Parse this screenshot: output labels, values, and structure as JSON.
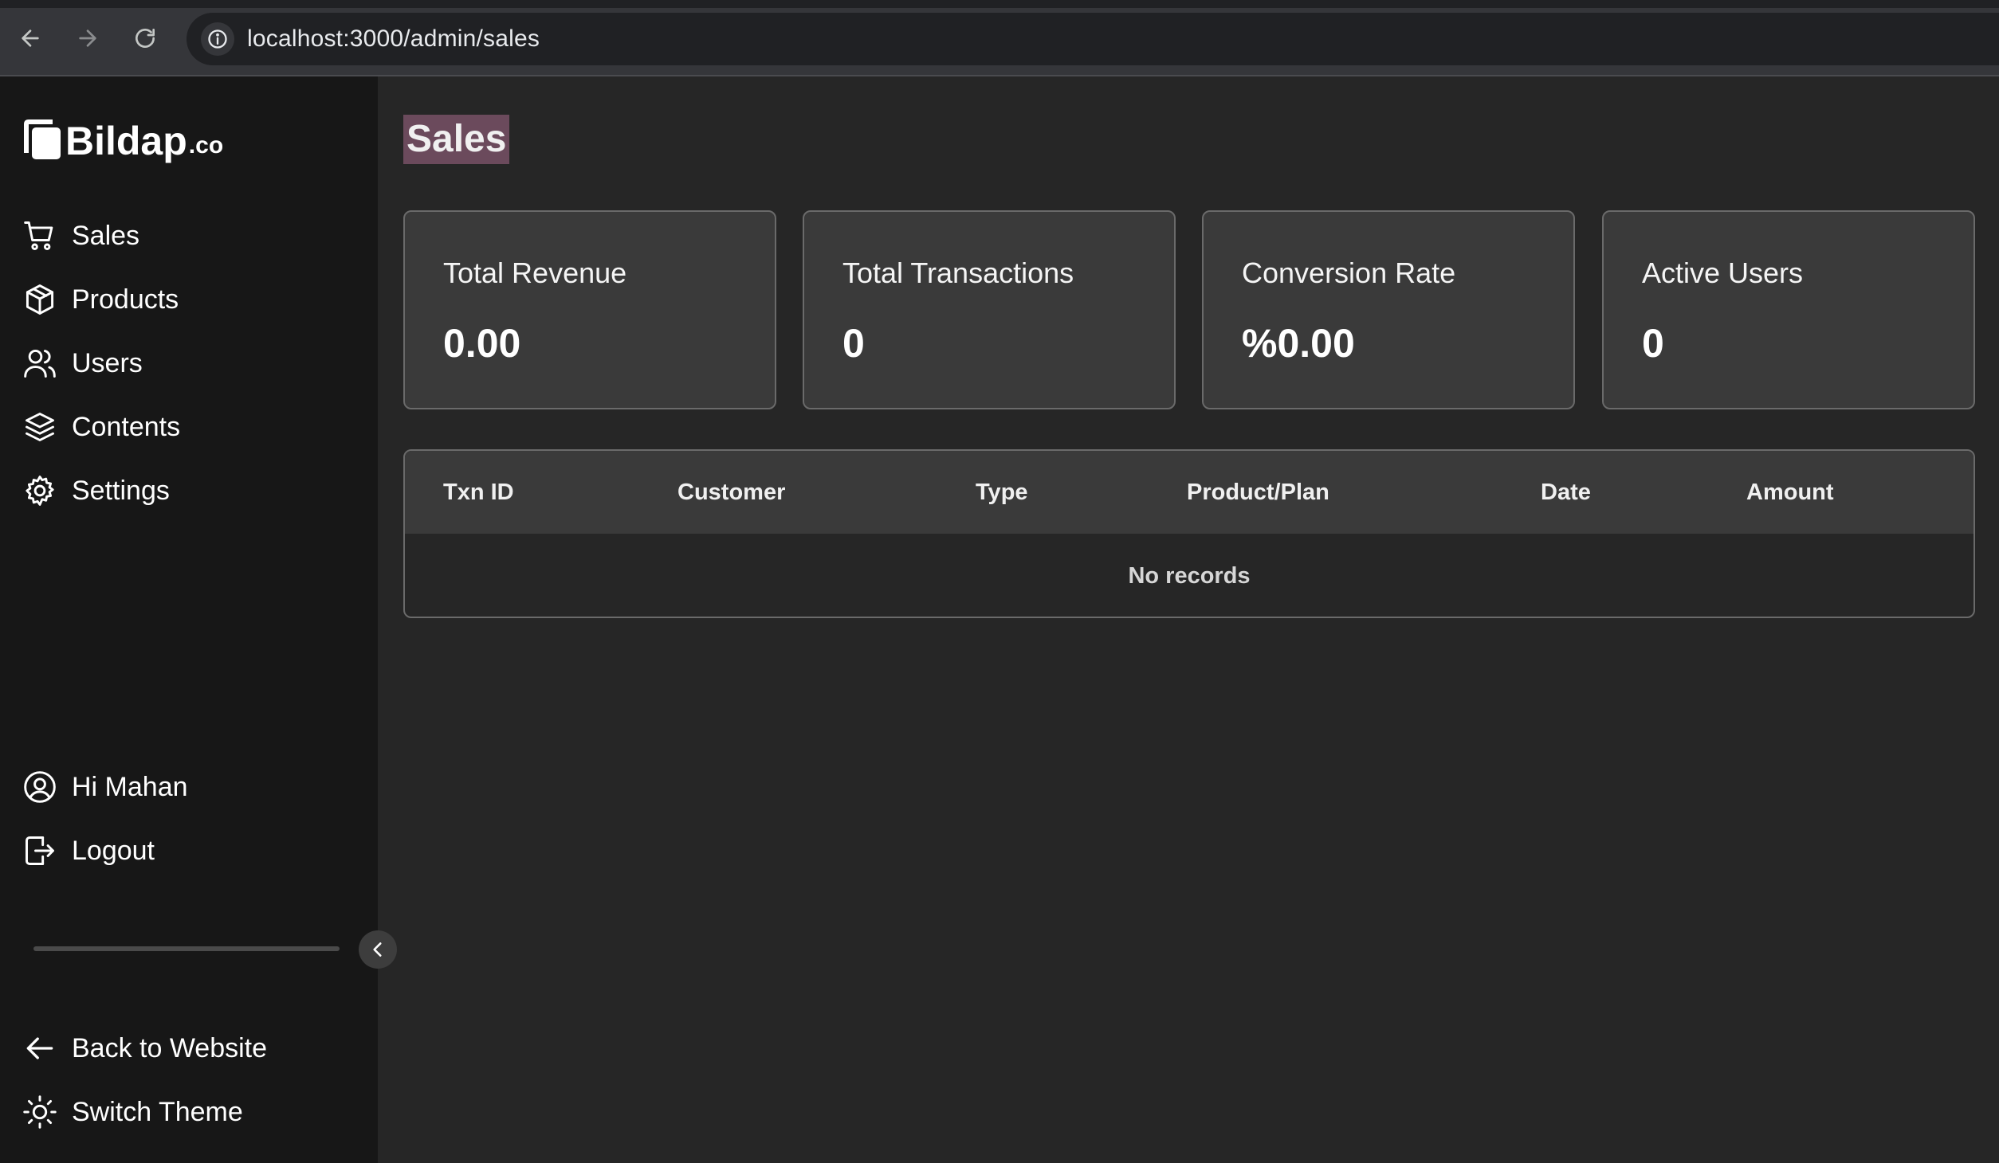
{
  "browser": {
    "url": "localhost:3000/admin/sales"
  },
  "sidebar": {
    "brand": {
      "name": "Bildap",
      "suffix": ".co"
    },
    "nav_items": [
      {
        "label": "Sales",
        "icon": "cart-icon"
      },
      {
        "label": "Products",
        "icon": "box-icon"
      },
      {
        "label": "Users",
        "icon": "users-icon"
      },
      {
        "label": "Contents",
        "icon": "layers-icon"
      },
      {
        "label": "Settings",
        "icon": "gear-icon"
      }
    ],
    "account_items": [
      {
        "label": "Hi Mahan",
        "icon": "user-circle-icon"
      },
      {
        "label": "Logout",
        "icon": "logout-icon"
      }
    ],
    "footer_items": [
      {
        "label": "Back to Website",
        "icon": "arrow-left-icon"
      },
      {
        "label": "Switch Theme",
        "icon": "sun-icon"
      }
    ]
  },
  "main": {
    "title": "Sales",
    "stats": [
      {
        "label": "Total Revenue",
        "value": "0.00"
      },
      {
        "label": "Total Transactions",
        "value": "0"
      },
      {
        "label": "Conversion Rate",
        "value": "%0.00"
      },
      {
        "label": "Active Users",
        "value": "0"
      }
    ],
    "table": {
      "columns": [
        "Txn ID",
        "Customer",
        "Type",
        "Product/Plan",
        "Date",
        "Amount"
      ],
      "empty_text": "No records"
    }
  },
  "colors": {
    "sidebar_bg": "#171717",
    "main_bg": "#262626",
    "card_bg": "#3a3a3a",
    "title_highlight": "#6b4a5c"
  }
}
